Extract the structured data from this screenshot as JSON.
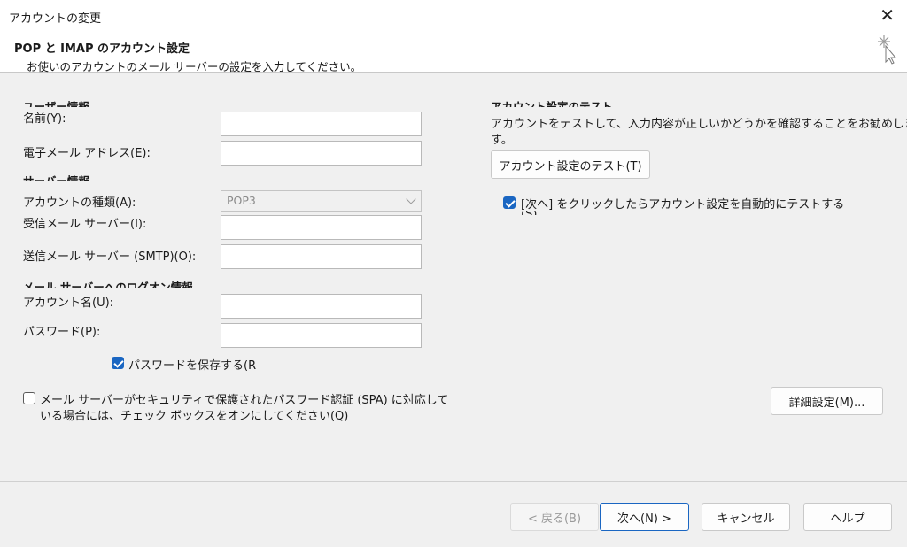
{
  "window": {
    "title": "アカウントの変更"
  },
  "header": {
    "title": "POP と IMAP のアカウント設定",
    "subtitle": "お使いのアカウントのメール サーバーの設定を入力してください。"
  },
  "user_info": {
    "heading": "ユーザー情報",
    "name_label": "名前(Y):",
    "name_value": "",
    "email_label": "電子メール アドレス(E):",
    "email_value": ""
  },
  "server_info": {
    "heading": "サーバー情報",
    "account_type_label": "アカウントの種類(A):",
    "account_type_value": "POP3",
    "incoming_label": "受信メール サーバー(I):",
    "incoming_value": "",
    "outgoing_label": "送信メール サーバー (SMTP)(O):",
    "outgoing_value": ""
  },
  "logon_info": {
    "heading": "メール サーバーへのログオン情報",
    "account_name_label": "アカウント名(U):",
    "account_name_value": "",
    "password_label": "パスワード(P):",
    "password_value": "",
    "save_password_label": "パスワードを保存する(R",
    "save_password_checked": true
  },
  "spa": {
    "label_line1": "メール サーバーがセキュリティで保護されたパスワード認証 (SPA) に対応して",
    "label_line2": "いる場合には、チェック ボックスをオンにしてください(Q)",
    "checked": false
  },
  "test_settings": {
    "heading": "アカウント設定のテスト",
    "desc_line1": "アカウントをテストして、入力内容が正しいかどうかを確認することをお勧めしま",
    "desc_line2": "す。",
    "test_button": "アカウント設定のテスト(T)",
    "auto_test_label": "[次へ] をクリックしたらアカウント設定を自動的にテストする",
    "auto_test_label_line2": "(S)",
    "auto_test_checked": true
  },
  "more_settings_button": "詳細設定(M)...",
  "footer": {
    "back": "< 戻る(B)",
    "next": "次へ(N) >",
    "cancel": "キャンセル",
    "help": "ヘルプ"
  },
  "colors": {
    "accent": "#1a66c2",
    "background": "#f0f0f0"
  }
}
